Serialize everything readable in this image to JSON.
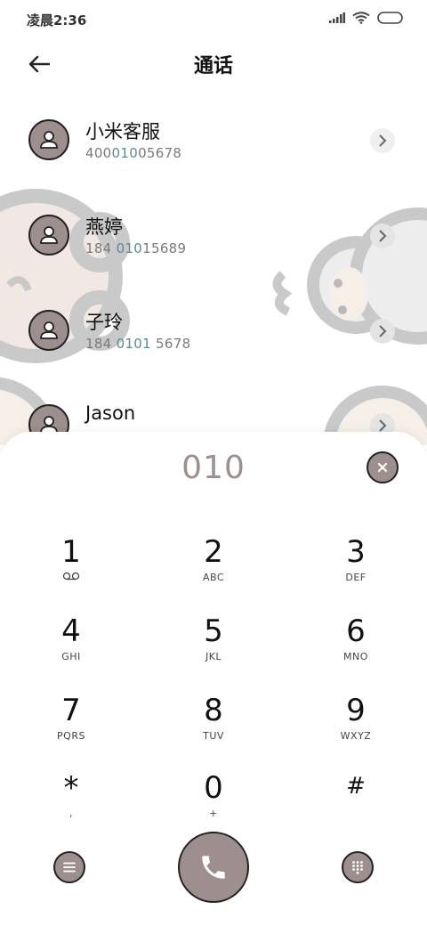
{
  "status_bar": {
    "time": "凌晨2:36",
    "icons": [
      "signal-icon",
      "wifi-icon",
      "battery-icon"
    ]
  },
  "header": {
    "title": "通话",
    "back_icon": "arrow-left-icon"
  },
  "contacts": [
    {
      "name": "小米客服",
      "number_pre": "400",
      "number_hl": "010",
      "number_post": "05678"
    },
    {
      "name": "燕婷",
      "number_pre": "184 ",
      "number_hl": "010",
      "number_post": "15689"
    },
    {
      "name": "子玲",
      "number_pre": "184 ",
      "number_hl": "0101",
      "number_post": " 5678"
    },
    {
      "name": "Jason",
      "number_pre": "",
      "number_hl": "",
      "number_post": ""
    }
  ],
  "dialpad": {
    "input": "010",
    "keys": [
      {
        "digit": "1",
        "letters": ""
      },
      {
        "digit": "2",
        "letters": "ABC"
      },
      {
        "digit": "3",
        "letters": "DEF"
      },
      {
        "digit": "4",
        "letters": "GHI"
      },
      {
        "digit": "5",
        "letters": "JKL"
      },
      {
        "digit": "6",
        "letters": "MNO"
      },
      {
        "digit": "7",
        "letters": "PQRS"
      },
      {
        "digit": "8",
        "letters": "TUV"
      },
      {
        "digit": "9",
        "letters": "WXYZ"
      },
      {
        "digit": "*",
        "letters": ","
      },
      {
        "digit": "0",
        "letters": "+"
      },
      {
        "digit": "#",
        "letters": ""
      }
    ]
  },
  "colors": {
    "accent": "#9c8f8d",
    "highlight_number": "#5a8a92",
    "outline": "#222222"
  }
}
